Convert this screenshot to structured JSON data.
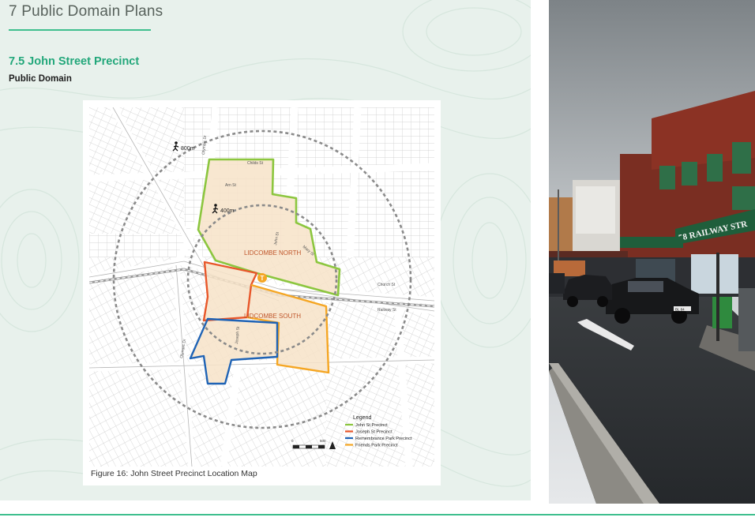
{
  "page": {
    "chapter_title": "7 Public Domain Plans",
    "section_title": "7.5 John Street Precinct",
    "section_subtitle": "Public Domain",
    "figure_caption": "Figure 16: John Street Precinct Location Map"
  },
  "map": {
    "radius_outer_label": "800m",
    "radius_inner_label": "400m",
    "area_north": "LIDCOMBE NORTH",
    "area_south": "LIDCOMBE SOUTH",
    "streets": {
      "olympic_dr": "Olympic Dr",
      "church_st": "Church St",
      "railway_st": "Railway St",
      "john_st": "John St",
      "joseph_st": "Joseph St",
      "mary_st": "Mary St",
      "childs_st": "Childs St",
      "arn_st": "Arn St"
    },
    "scale_left": "0",
    "scale_right": "500",
    "legend": {
      "title": "Legend",
      "items": [
        {
          "label": "John St Precinct",
          "color": "#8cc63f"
        },
        {
          "label": "Joseph St Precinct",
          "color": "#e8572a"
        },
        {
          "label": "Remembrance Park Precinct",
          "color": "#1f63b5"
        },
        {
          "label": "Friends Park Precinct",
          "color": "#f5a623"
        }
      ]
    }
  },
  "photo": {
    "shop_sign": "58 RAILWAY STR",
    "plate": "BL 84"
  },
  "colors": {
    "accent": "#3fbf8e",
    "heading": "#22a77a",
    "precinct_fill": "#f7e3c8"
  }
}
